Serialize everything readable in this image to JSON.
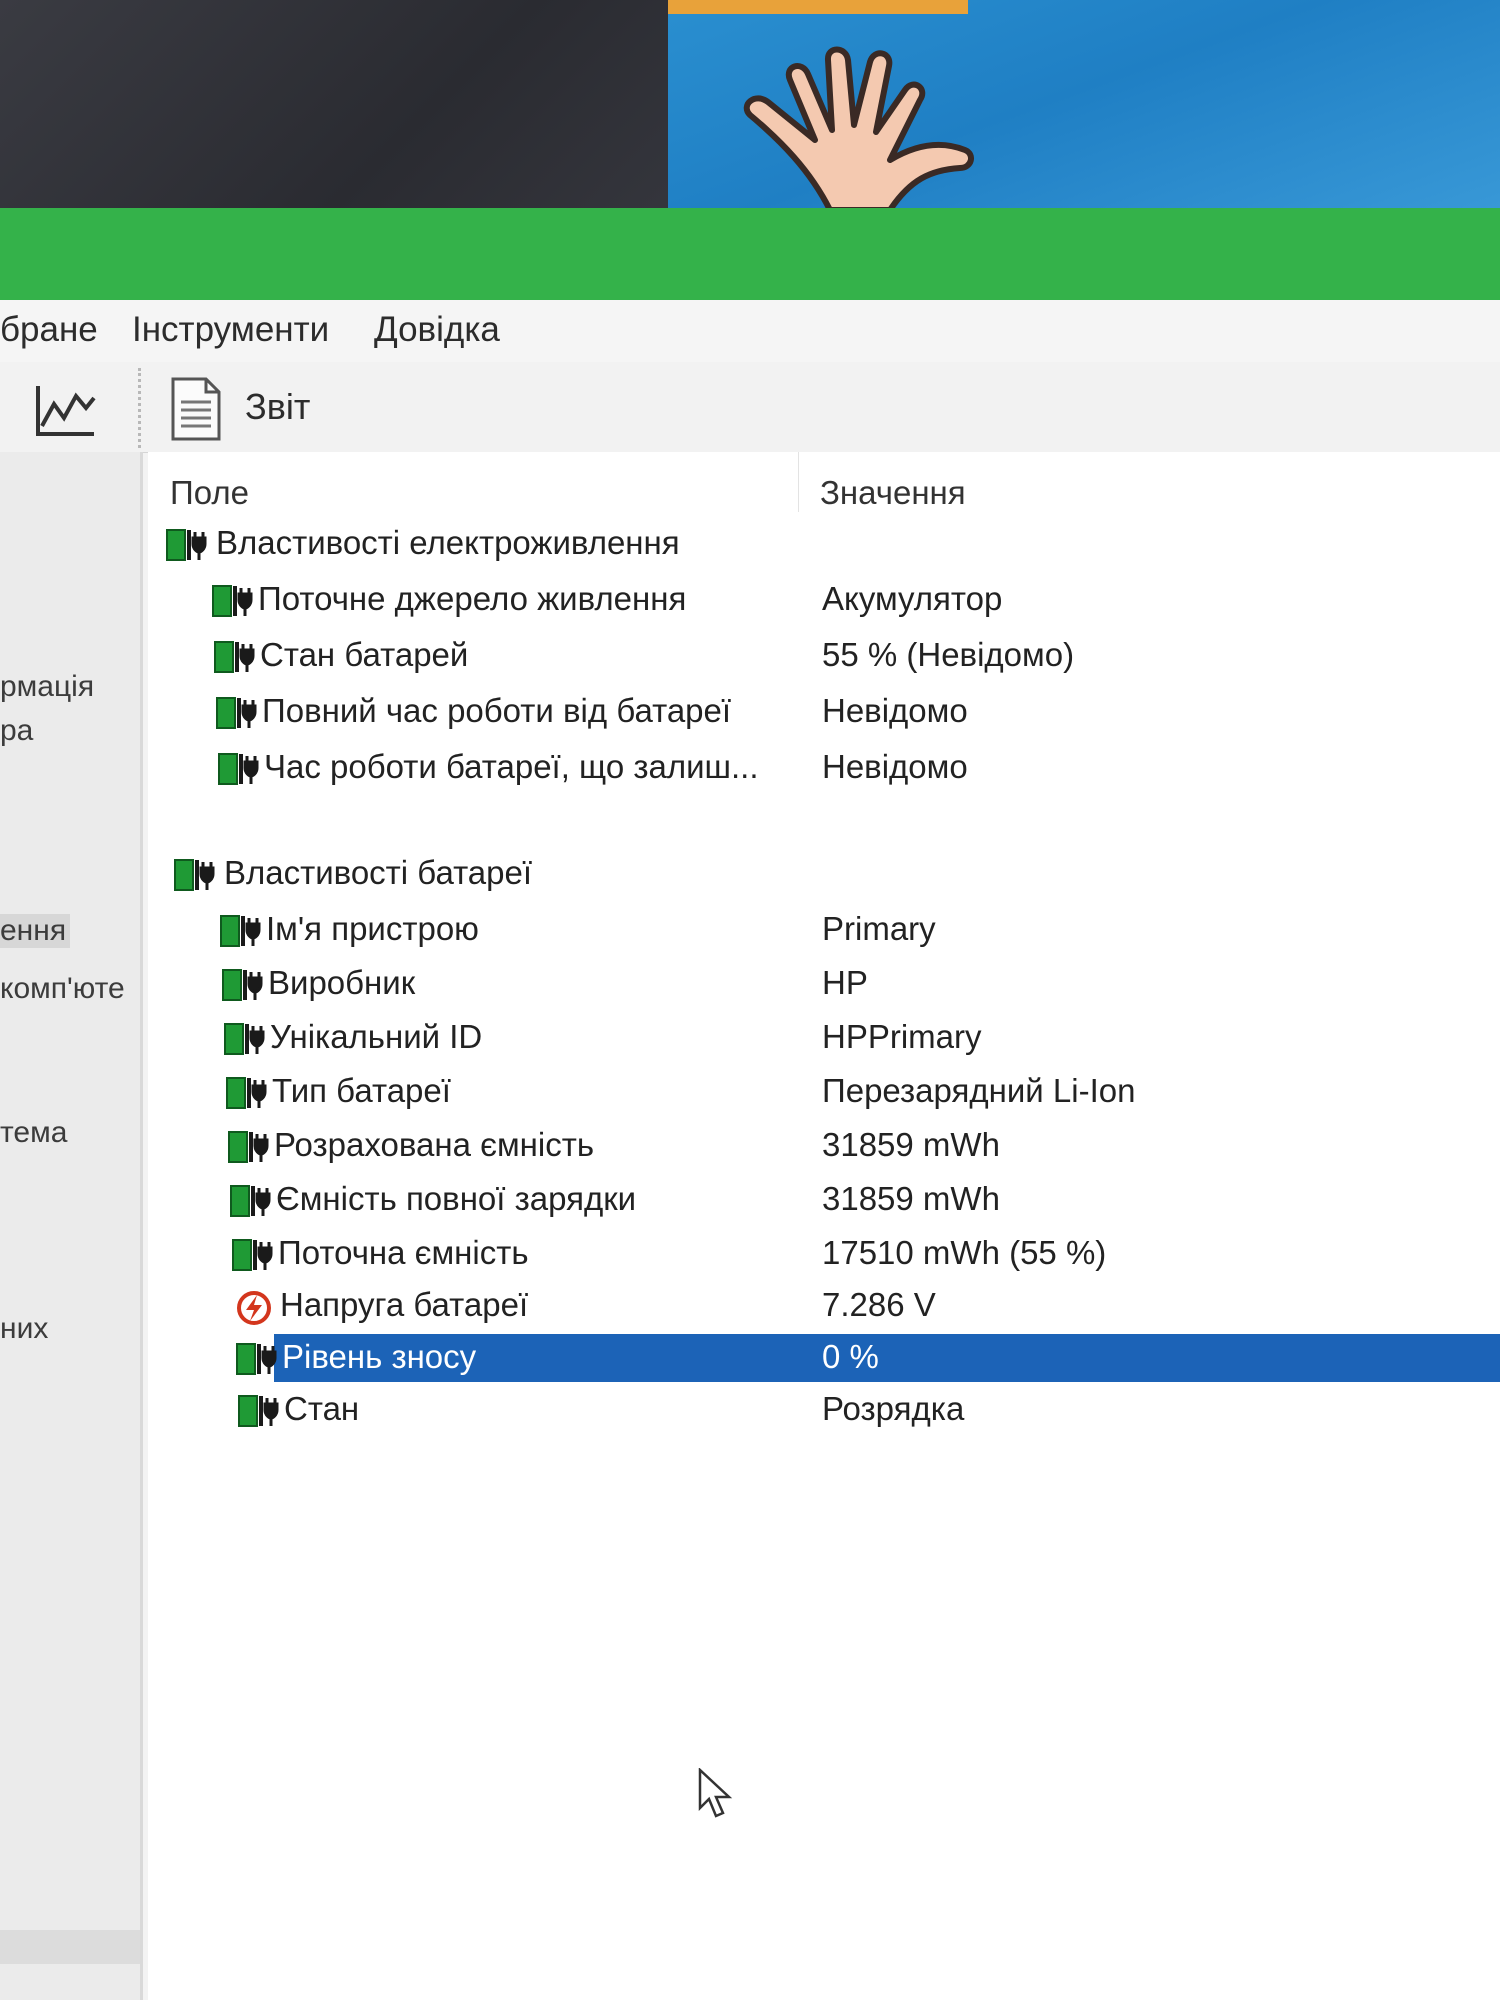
{
  "menu": {
    "items": [
      "бране",
      "Інструменти",
      "Довідка"
    ]
  },
  "toolbar": {
    "report_label": "Звіт"
  },
  "sidebar": {
    "items": [
      "рмація",
      "ра",
      "ення",
      "комп'юте",
      "тема",
      "них"
    ],
    "selected_index": 2
  },
  "columns": {
    "field": "Поле",
    "value": "Значення"
  },
  "groups": [
    {
      "title": "Властивості електроживлення",
      "rows": [
        {
          "label": "Поточне джерело живлення",
          "value": "Акумулятор",
          "icon": "battery-plug-icon"
        },
        {
          "label": "Стан батарей",
          "value": "55 % (Невідомо)",
          "icon": "battery-plug-icon"
        },
        {
          "label": "Повний час роботи від батареї",
          "value": "Невідомо",
          "icon": "battery-plug-icon"
        },
        {
          "label": "Час роботи батареї, що залиш...",
          "value": "Невідомо",
          "icon": "battery-plug-icon"
        }
      ]
    },
    {
      "title": "Властивості батареї",
      "rows": [
        {
          "label": "Ім'я пристрою",
          "value": "Primary",
          "icon": "battery-plug-icon"
        },
        {
          "label": "Виробник",
          "value": "HP",
          "icon": "battery-plug-icon"
        },
        {
          "label": "Унікальний ID",
          "value": "HPPrimary",
          "icon": "battery-plug-icon"
        },
        {
          "label": "Тип батареї",
          "value": "Перезарядний Li-Ion",
          "icon": "battery-plug-icon"
        },
        {
          "label": "Розрахована ємність",
          "value": "31859 mWh",
          "icon": "battery-plug-icon"
        },
        {
          "label": "Ємність повної зарядки",
          "value": "31859 mWh",
          "icon": "battery-plug-icon"
        },
        {
          "label": "Поточна ємність",
          "value": "17510 mWh  (55 %)",
          "icon": "battery-plug-icon"
        },
        {
          "label": "Напруга батареї",
          "value": "7.286 V",
          "icon": "voltage-icon"
        },
        {
          "label": "Рівень зносу",
          "value": "0 %",
          "icon": "battery-plug-icon",
          "selected": true
        },
        {
          "label": "Стан",
          "value": "Розрядка",
          "icon": "battery-plug-icon"
        }
      ]
    }
  ],
  "colors": {
    "title_bar": "#34b24a",
    "selection": "#1c63b7",
    "battery_green": "#1f9a35"
  }
}
